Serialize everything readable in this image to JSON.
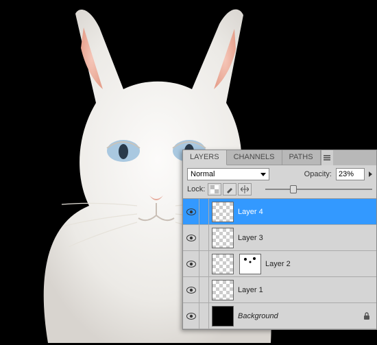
{
  "panel": {
    "tabs": {
      "layers": "LAYERS",
      "channels": "CHANNELS",
      "paths": "PATHS"
    },
    "blendMode": "Normal",
    "opacityLabel": "Opacity:",
    "opacityValue": "23%",
    "lockLabel": "Lock:",
    "sliderPct": 23
  },
  "layers": [
    {
      "name": "Layer 4",
      "thumb": "checker",
      "selected": true,
      "locked": false
    },
    {
      "name": "Layer 3",
      "thumb": "checker",
      "selected": false,
      "locked": false
    },
    {
      "name": "Layer 2",
      "thumb": "checker",
      "mask": true,
      "selected": false,
      "locked": false
    },
    {
      "name": "Layer 1",
      "thumb": "checker",
      "selected": false,
      "locked": false
    },
    {
      "name": "Background",
      "thumb": "black",
      "selected": false,
      "locked": true,
      "italic": true
    }
  ]
}
